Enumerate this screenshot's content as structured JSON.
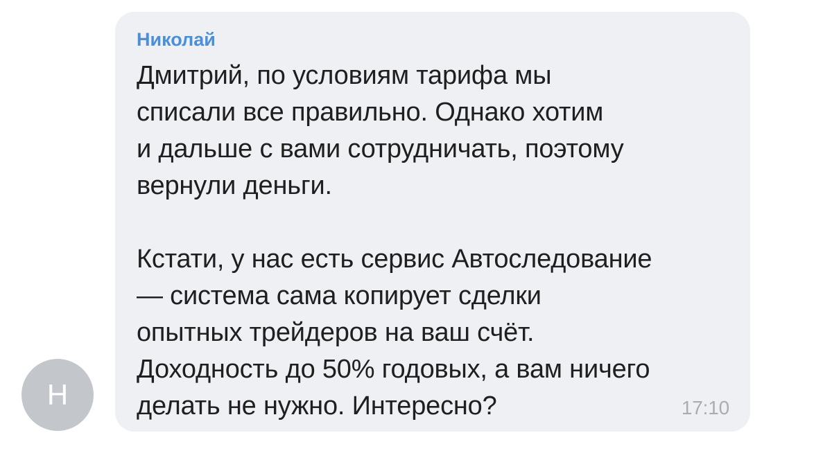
{
  "avatar": {
    "initial": "Н",
    "color": "#c3c7cc"
  },
  "message": {
    "sender": "Николай",
    "sender_color": "#4a8fd9",
    "lines": [
      "Дмитрий, по условиям тарифа мы",
      "списали все правильно. Однако хотим",
      "и дальше с вами сотрудничать, поэтому",
      "вернули деньги.",
      "",
      "Кстати, у нас есть сервис Автоследование",
      "— система сама копирует сделки",
      "опытных трейдеров на ваш счёт.",
      "Доходность до 50% годовых, а вам ничего",
      "делать не нужно. Интересно?"
    ],
    "time": "17:10",
    "bubble_color": "#eef0f3"
  }
}
